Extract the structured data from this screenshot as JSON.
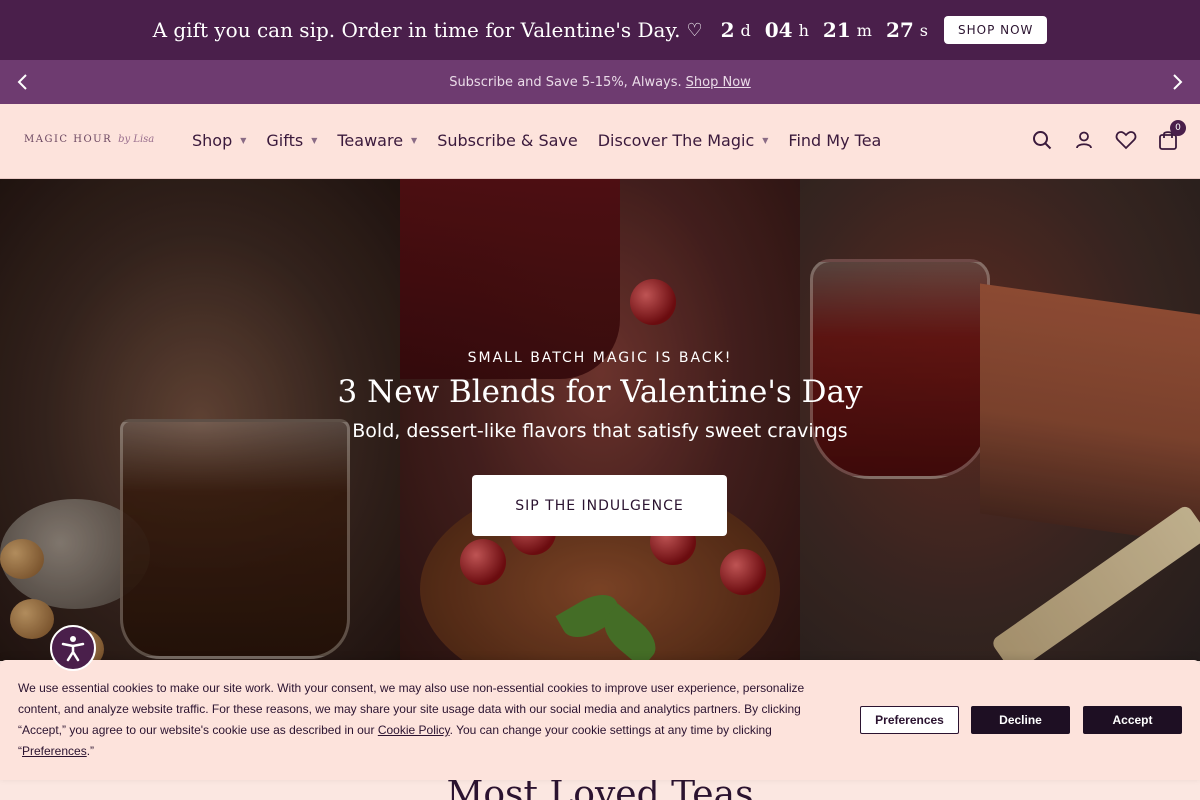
{
  "promo": {
    "text": "A gift you can sip. Order in time for Valentine's Day.",
    "heart_icon": "heart-icon",
    "countdown": [
      {
        "value": "2",
        "unit": "d"
      },
      {
        "value": "04",
        "unit": "h"
      },
      {
        "value": "21",
        "unit": "m"
      },
      {
        "value": "27",
        "unit": "s"
      }
    ],
    "cta": "SHOP NOW"
  },
  "announcement": {
    "text": "Subscribe and Save 5-15%, Always.",
    "link": "Shop Now",
    "prev_icon": "chevron-left-icon",
    "next_icon": "chevron-right-icon"
  },
  "header": {
    "logo": "MAGIC HOUR",
    "logo_sub": "by Lisa",
    "nav": [
      {
        "label": "Shop",
        "dropdown": true
      },
      {
        "label": "Gifts",
        "dropdown": true
      },
      {
        "label": "Teaware",
        "dropdown": true
      },
      {
        "label": "Subscribe & Save",
        "dropdown": false
      },
      {
        "label": "Discover The Magic",
        "dropdown": true
      },
      {
        "label": "Find My Tea",
        "dropdown": false
      }
    ],
    "cart_count": "0"
  },
  "hero": {
    "eyebrow": "SMALL BATCH MAGIC IS BACK!",
    "title": "3 New Blends for Valentine's Day",
    "subtitle": "Bold, dessert-like flavors that satisfy sweet cravings",
    "cta": "SIP THE INDULGENCE"
  },
  "cookie": {
    "text_1": "We use essential cookies to make our site work. With your consent, we may also use non-essential cookies to improve user experience, personalize content, and analyze website traffic. For these reasons, we may share your site usage data with our social media and analytics partners. By clicking “Accept,” you agree to our website's cookie use as described in our",
    "policy_link": "Cookie Policy",
    "text_2": ". You can change your cookie settings at any time by clicking “",
    "prefs_link": "Preferences",
    "text_3": ".”",
    "buttons": {
      "preferences": "Preferences",
      "decline": "Decline",
      "accept": "Accept"
    }
  },
  "section": {
    "title": "Most Loved Teas"
  },
  "colors": {
    "primary": "#4a1f4b",
    "announce": "#6e3b70",
    "background": "#fbe7e1",
    "dark_button": "#1e0f23"
  }
}
